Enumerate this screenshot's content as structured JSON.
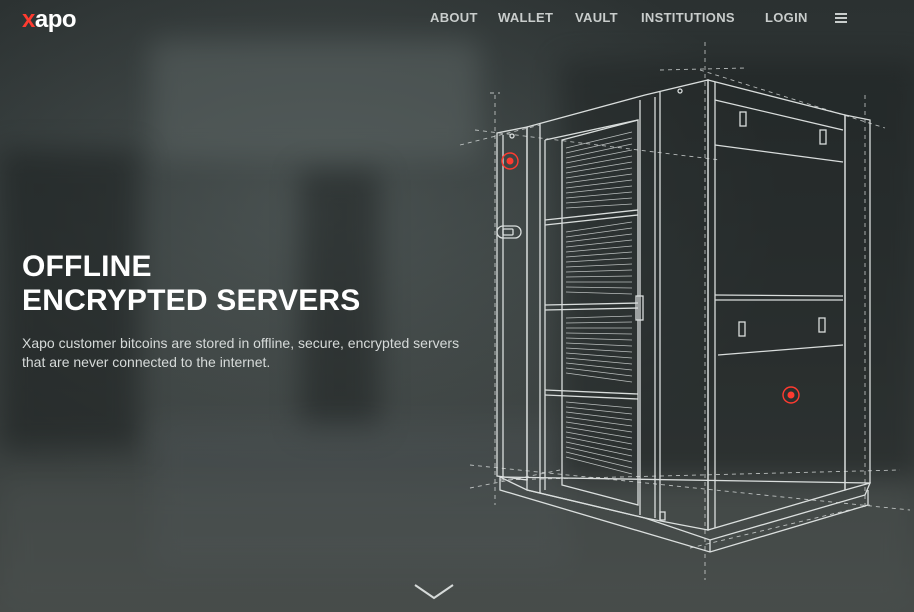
{
  "header": {
    "logo": "xapo",
    "nav": [
      {
        "label": "ABOUT"
      },
      {
        "label": "WALLET"
      },
      {
        "label": "VAULT"
      },
      {
        "label": "INSTITUTIONS"
      },
      {
        "label": "LOGIN"
      }
    ],
    "menu_icon": "hamburger-icon"
  },
  "hero": {
    "headline_line1": "OFFLINE",
    "headline_line2": "ENCRYPTED SERVERS",
    "description": "Xapo customer bitcoins are stored in offline, secure, encrypted servers that are never connected to the internet.",
    "illustration": "server-rack-illustration",
    "scroll_icon": "chevron-down-icon"
  },
  "colors": {
    "brand_red": "#ff3b30",
    "line_white": "#e8eceb",
    "nav_text": "#c9cdcc"
  }
}
